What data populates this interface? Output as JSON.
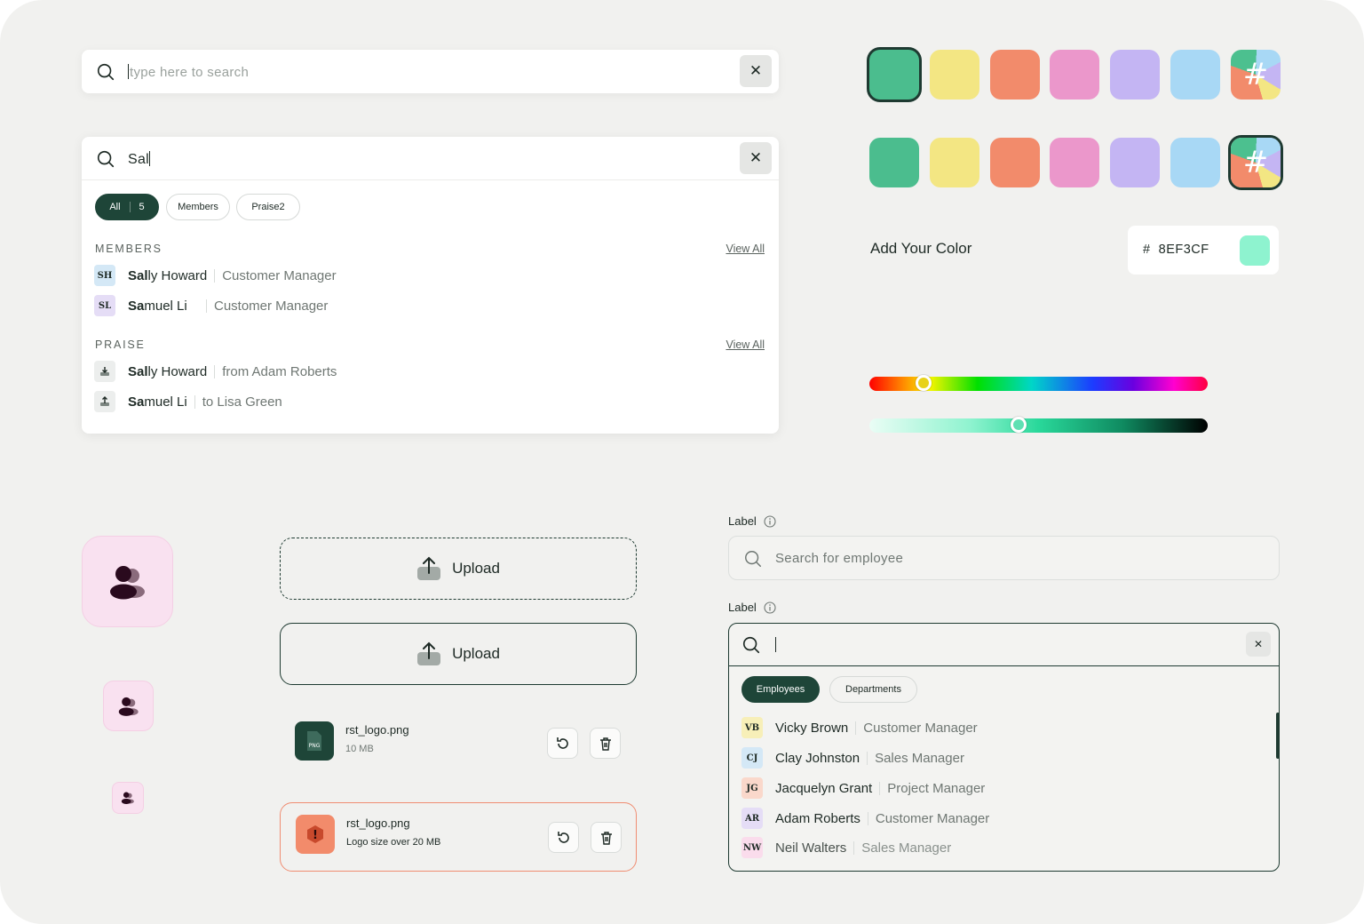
{
  "search_default": {
    "placeholder": "type here to search",
    "clear": "✕"
  },
  "search_active": {
    "query": "Sal",
    "clear": "✕",
    "filters": [
      {
        "label": "All",
        "count": "5"
      },
      {
        "label": "Members"
      },
      {
        "label": "Praise2"
      }
    ],
    "members_title": "MEMBERS",
    "praise_title": "PRAISE",
    "view_all": "View All",
    "members": [
      {
        "initials": "SH",
        "match": "Sal",
        "rest": "ly Howard",
        "role": "Customer Manager",
        "color": "#d4e8f6"
      },
      {
        "initials": "SL",
        "match": "Sa",
        "rest": "muel Li",
        "role": "Customer Manager",
        "color": "#e5ddf6"
      }
    ],
    "praise": [
      {
        "icon": "praise-down-icon",
        "match": "Sal",
        "rest": "ly Howard",
        "detail": "from Adam Roberts"
      },
      {
        "icon": "praise-up-icon",
        "match": "Sa",
        "rest": "muel Li",
        "detail": "to Lisa Green"
      }
    ]
  },
  "swatches": {
    "colors": [
      "#4bbd8e",
      "#f3e683",
      "#f28b6b",
      "#eb97cb",
      "#c4b5f3",
      "#a8d8f5"
    ],
    "custom_icon": "#",
    "row1_selected": 0,
    "row2_selected": 6
  },
  "add_color": {
    "label": "Add Your Color",
    "hex_prefix": "#",
    "hex_value": "8EF3CF",
    "preview_color": "#8EF3CF",
    "hue_level": 0.16,
    "shade_level": 0.44
  },
  "upload": {
    "label": "Upload",
    "files": [
      {
        "name": "rst_logo.png",
        "meta": "10 MB",
        "badge": "PNG",
        "status": "ok",
        "icon_color": "#1e4538"
      },
      {
        "name": "rst_logo.png",
        "meta": "Logo size over 20 MB",
        "badge": "!",
        "status": "error",
        "icon_color": "#f28b6b"
      }
    ]
  },
  "employee_search": {
    "label": "Label",
    "placeholder": "Search for employee",
    "clear": "✕",
    "tabs": [
      {
        "label": "Employees"
      },
      {
        "label": "Departments"
      }
    ],
    "results": [
      {
        "initials": "VB",
        "name": "Vicky Brown",
        "role": "Customer Manager",
        "color": "#f7efb8"
      },
      {
        "initials": "CJ",
        "name": "Clay Johnston",
        "role": "Sales Manager",
        "color": "#d4e8f6"
      },
      {
        "initials": "JG",
        "name": "Jacquelyn Grant",
        "role": "Project Manager",
        "color": "#fad8cb"
      },
      {
        "initials": "AR",
        "name": "Adam Roberts",
        "role": "Customer Manager",
        "color": "#e5ddf6"
      },
      {
        "initials": "NW",
        "name": "Neil Walters",
        "role": "Sales Manager",
        "color": "#fadcec"
      }
    ]
  }
}
